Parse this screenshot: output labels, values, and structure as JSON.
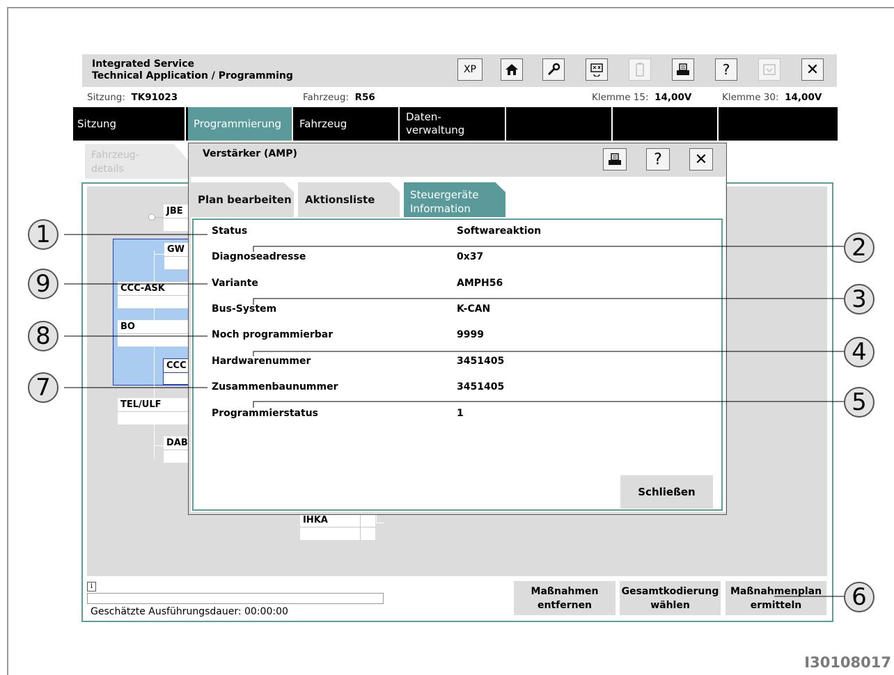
{
  "app": {
    "title_line1": "Integrated Service",
    "title_line2": "Technical Application / Programming"
  },
  "toolbar": {
    "xp_label": "XP",
    "help_label": "?",
    "close_label": "✕"
  },
  "status": {
    "session_label": "Sitzung:",
    "session_value": "TK91023",
    "vehicle_label": "Fahrzeug:",
    "vehicle_value": "R56",
    "k15_label": "Klemme 15:",
    "k15_value": "14,00V",
    "k30_label": "Klemme 30:",
    "k30_value": "14,00V"
  },
  "nav": {
    "tabs": [
      {
        "label": "Sitzung"
      },
      {
        "label": "Programmierung"
      },
      {
        "label": "Fahrzeug"
      },
      {
        "label_line1": "Daten-",
        "label_line2": "verwaltung"
      }
    ],
    "subtab_line1": "Fahrzeug-",
    "subtab_line2": "details"
  },
  "ecus": {
    "jbe": "JBE",
    "gw": "GW",
    "ccc_ask": "CCC-ASK",
    "bo": "BO",
    "ccc": "CCC",
    "tel_ulf": "TEL/ULF",
    "dab": "DAB",
    "ihka": "IHKA"
  },
  "footer": {
    "info_icon": "i",
    "duration": "Geschätzte Ausführungsdauer: 00:00:00",
    "btn_remove_line1": "Maßnahmen",
    "btn_remove_line2": "entfernen",
    "btn_coding_line1": "Gesamtkodierung",
    "btn_coding_line2": "wählen",
    "btn_plan_line1": "Maßnahmenplan",
    "btn_plan_line2": "ermitteln"
  },
  "dialog": {
    "title": "Verstärker (AMP)",
    "help_label": "?",
    "close_label": "✕",
    "tabs": {
      "plan": "Plan bearbeiten",
      "actions": "Aktionsliste",
      "ecu_info_line1": "Steuergeräte",
      "ecu_info_line2": "Information"
    },
    "rows": [
      {
        "label": "Status",
        "value": "Softwareaktion"
      },
      {
        "label": "Diagnoseadresse",
        "value": "0x37"
      },
      {
        "label": "Variante",
        "value": "AMPH56"
      },
      {
        "label": "Bus-System",
        "value": "K-CAN"
      },
      {
        "label": "Noch programmierbar",
        "value": "9999"
      },
      {
        "label": "Hardwarenummer",
        "value": "3451405"
      },
      {
        "label": "Zusammenbaunummer",
        "value": "3451405"
      },
      {
        "label": "Programmierstatus",
        "value": "1"
      }
    ],
    "close_button": "Schließen"
  },
  "callouts": [
    "1",
    "2",
    "3",
    "4",
    "5",
    "6",
    "7",
    "8",
    "9"
  ],
  "figure_id": "I30108017",
  "colors": {
    "accent": "#5a9a9b",
    "nav_bg": "#000000",
    "panel_gray": "#dcdcdc",
    "selection_blue": "#a9ccf0"
  }
}
